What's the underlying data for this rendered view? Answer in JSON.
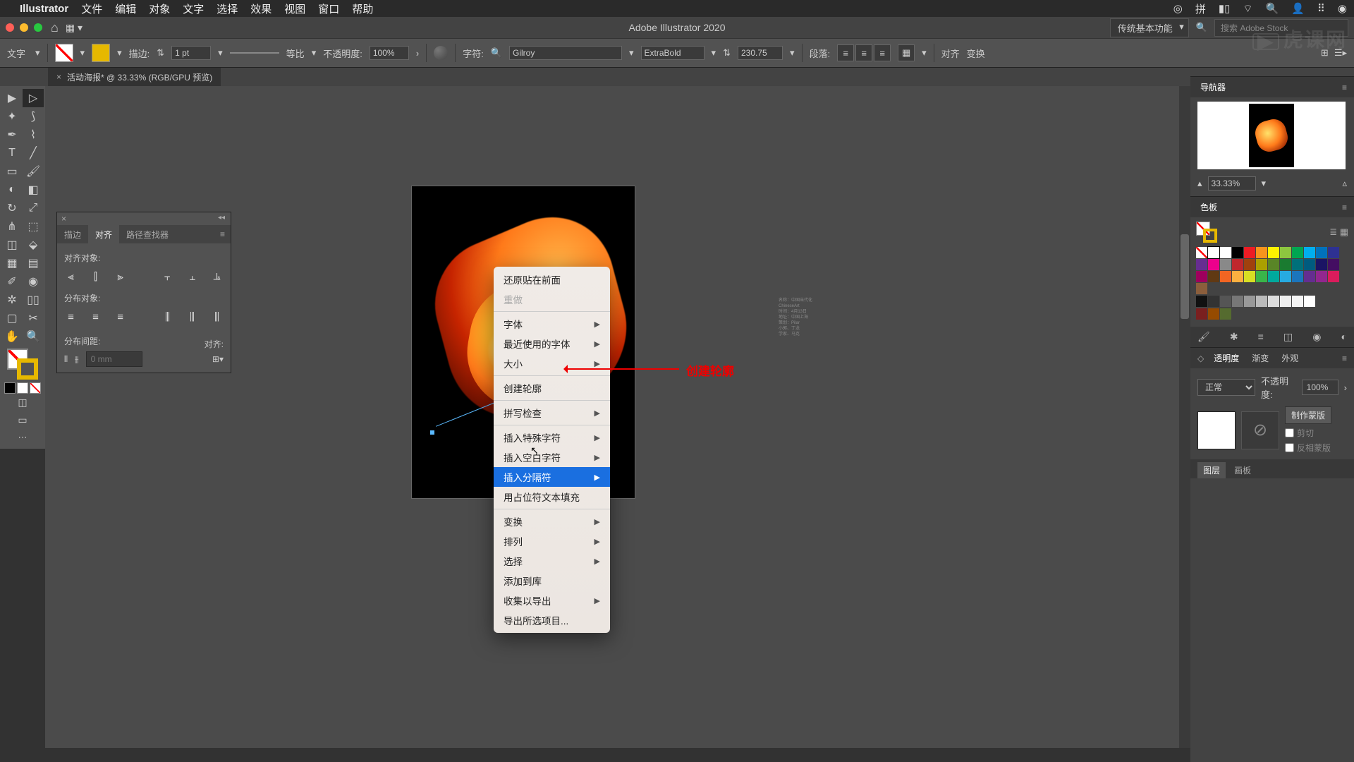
{
  "menubar": {
    "app": "Illustrator",
    "items": [
      "文件",
      "编辑",
      "对象",
      "文字",
      "选择",
      "效果",
      "视图",
      "窗口",
      "帮助"
    ],
    "right_pin": "拼"
  },
  "titlebar": {
    "title": "Adobe Illustrator 2020",
    "workspace": "传统基本功能",
    "search_placeholder": "搜索 Adobe Stock"
  },
  "watermark": "虎课网",
  "options": {
    "tool_label": "文字",
    "stroke_label": "描边:",
    "stroke_weight": "1 pt",
    "profile_label": "等比",
    "opacity_label": "不透明度:",
    "opacity_value": "100%",
    "char_label": "字符:",
    "font_family": "Gilroy",
    "font_style": "ExtraBold",
    "font_size": "230.75",
    "para_label": "段落:",
    "align_label": "对齐",
    "transform_label": "变换"
  },
  "tab": {
    "name": "活动海报* @ 33.33% (RGB/GPU 预览)"
  },
  "align_panel": {
    "tabs": [
      "描边",
      "对齐",
      "路径查找器"
    ],
    "active_tab": 1,
    "sec1": "对齐对象:",
    "sec2": "分布对象:",
    "sec3": "分布间距:",
    "align_to_label": "对齐:",
    "spacing_value": "0 mm"
  },
  "context_menu": {
    "items": [
      {
        "label": "还原贴在前面",
        "sub": false
      },
      {
        "label": "重做",
        "sub": false,
        "disabled": true
      },
      {
        "sep": true
      },
      {
        "label": "字体",
        "sub": true
      },
      {
        "label": "最近使用的字体",
        "sub": true
      },
      {
        "label": "大小",
        "sub": true
      },
      {
        "sep": true
      },
      {
        "label": "创建轮廓",
        "sub": false
      },
      {
        "sep": true
      },
      {
        "label": "拼写检查",
        "sub": true
      },
      {
        "sep": true
      },
      {
        "label": "插入特殊字符",
        "sub": true
      },
      {
        "label": "插入空白字符",
        "sub": true
      },
      {
        "label": "插入分隔符",
        "sub": true,
        "hl": true
      },
      {
        "label": "用占位符文本填充",
        "sub": false
      },
      {
        "sep": true
      },
      {
        "label": "变换",
        "sub": true
      },
      {
        "label": "排列",
        "sub": true
      },
      {
        "label": "选择",
        "sub": true
      },
      {
        "label": "添加到库",
        "sub": false
      },
      {
        "label": "收集以导出",
        "sub": true
      },
      {
        "label": "导出所选项目...",
        "sub": false
      }
    ]
  },
  "annotation": "创建轮廓",
  "right": {
    "navigator": "导航器",
    "nav_zoom": "33.33%",
    "swatches": "色板",
    "transparency_tabs": [
      "透明度",
      "渐变",
      "外观"
    ],
    "blend_mode": "正常",
    "opacity_label": "不透明度:",
    "opacity_value": "100%",
    "make_mask": "制作蒙版",
    "clip": "剪切",
    "invert": "反相蒙版",
    "bottom_tabs": [
      "图层",
      "画板"
    ]
  },
  "swatch_colors": [
    "#ffffff",
    "#000000",
    "#ed1c24",
    "#f7941d",
    "#fff200",
    "#8dc63f",
    "#00a651",
    "#00aeef",
    "#0072bc",
    "#2e3192",
    "#662d91",
    "#ec008c",
    "#898989",
    "#c0272d",
    "#a0410d",
    "#aba000",
    "#598527",
    "#1a7b30",
    "#00707a",
    "#005b7f",
    "#1b1464",
    "#440e62",
    "#9e005d",
    "#603913",
    "#f26522",
    "#fbb040",
    "#d7df23",
    "#39b54a",
    "#00a99d",
    "#27aae1",
    "#1b75bc",
    "#652d90",
    "#92278f",
    "#da1c5c",
    "#8b5e3c"
  ],
  "gray_row": [
    "#111",
    "#333",
    "#555",
    "#777",
    "#999",
    "#bbb",
    "#ddd",
    "#eee",
    "#f5f5f5",
    "#fff"
  ],
  "extra_row": [
    "#7a1f1f",
    "#964b00",
    "#556b2f"
  ]
}
